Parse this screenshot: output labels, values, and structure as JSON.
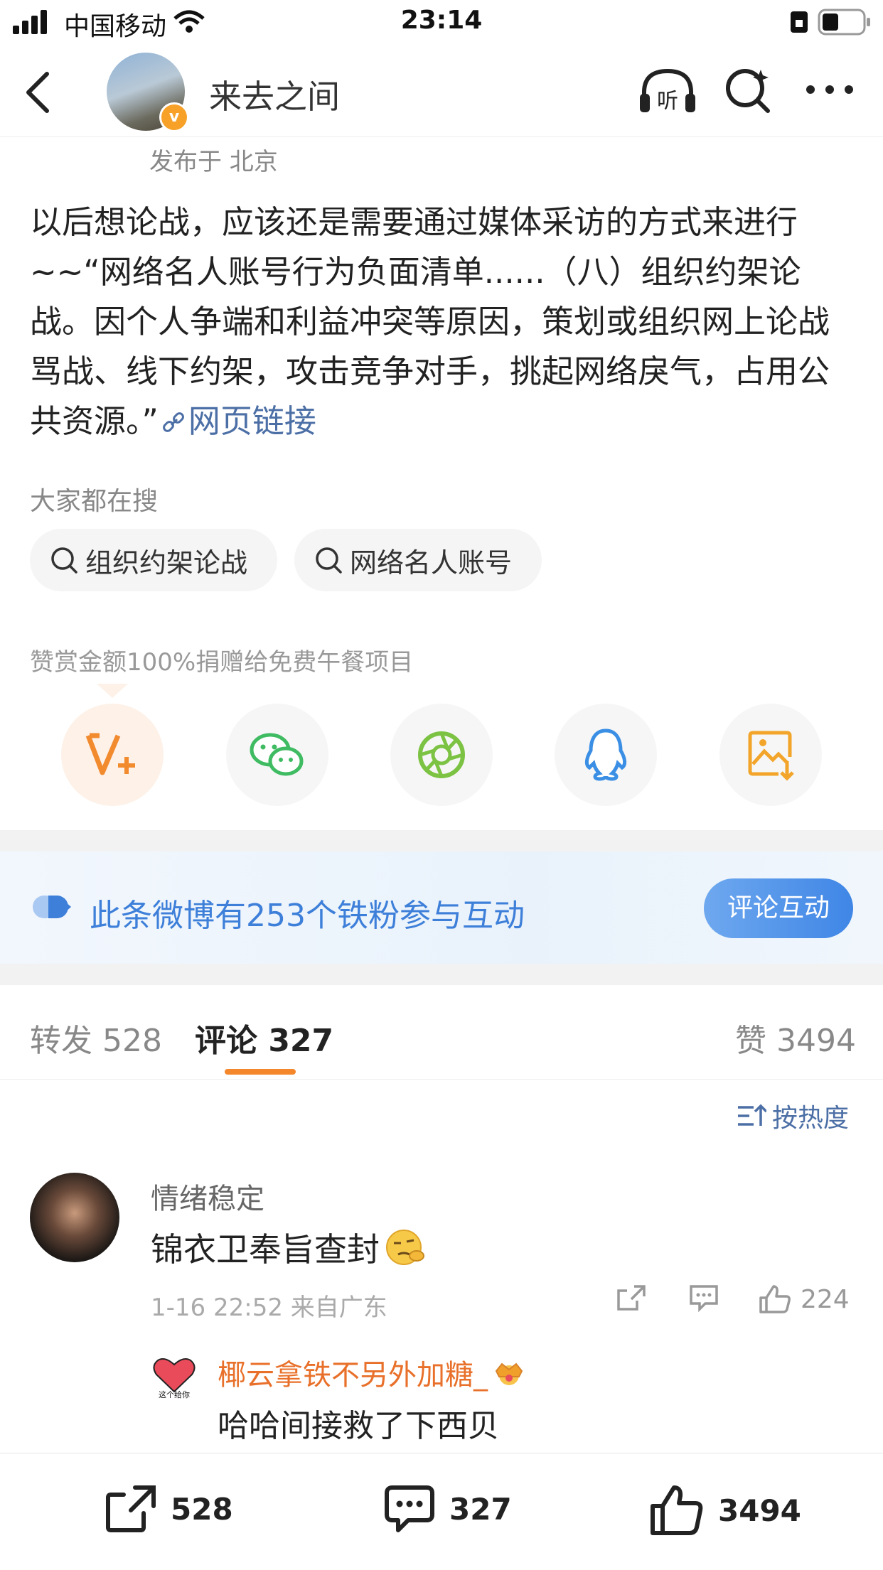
{
  "status_bar": {
    "carrier": "中国移动",
    "time": "23:14"
  },
  "nav": {
    "title": "来去之间",
    "listen_label": "听"
  },
  "post": {
    "location": "发布于 北京",
    "text": "以后想论战，应该还是需要通过媒体采访的方式来进行~~“网络名人账号行为负面清单......（八）组织约架论战。因个人争端和利益冲突等原因，策划或组织网上论战骂战、线下约架，攻击竞争对手，挑起网络戾气，占用公共资源。”",
    "link_label": "网页链接"
  },
  "search": {
    "label": "大家都在搜",
    "chips": [
      "组织约架论战",
      "网络名人账号"
    ]
  },
  "reward_note": "赞赏金额100%捐赠给免费午餐项目",
  "banner": {
    "text": "此条微博有253个铁粉参与互动",
    "button": "评论互动"
  },
  "tabs": {
    "repost": "转发 528",
    "comment": "评论 327",
    "like": "赞 3494"
  },
  "sort_label": "按热度",
  "comment": {
    "name": "情绪稳定",
    "text": "锦衣卫奉旨查封",
    "meta": "1-16 22:52 来自广东",
    "likes": "224",
    "reply": {
      "name": "椰云拿铁不另外加糖_",
      "text": "哈哈间接救了下西贝",
      "avatar_caption": "这个给你"
    }
  },
  "bottom_bar": {
    "repost": "528",
    "comment": "327",
    "like": "3494"
  },
  "colors": {
    "link": "#4c6fa6",
    "accent": "#f4862b",
    "banner_blue": "#3d7fd9"
  }
}
